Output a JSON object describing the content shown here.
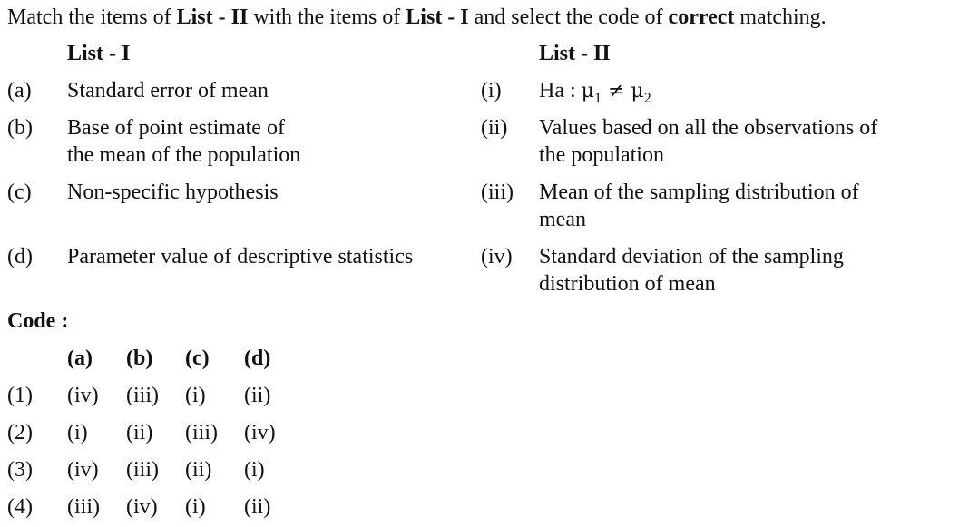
{
  "question": {
    "prefix_1": "Match the items of ",
    "list2_bold": "List - II",
    "prefix_2": " with the items of ",
    "list1_bold": "List - I",
    "prefix_3": " and select the code of ",
    "correct_bold": "correct",
    "suffix": " matching."
  },
  "list1": {
    "heading": "List - I",
    "items": [
      {
        "label": "(a)",
        "lines": [
          "Standard error of mean"
        ]
      },
      {
        "label": "(b)",
        "lines": [
          "Base of point estimate of",
          "the mean of the population"
        ]
      },
      {
        "label": "(c)",
        "lines": [
          "Non-specific hypothesis"
        ]
      },
      {
        "label": "(d)",
        "lines": [
          "Parameter value of descriptive statistics"
        ]
      }
    ]
  },
  "list2": {
    "heading": "List - II",
    "items": [
      {
        "label": "(i)",
        "ha": "Ha : ",
        "mu": "μ",
        "sub1": "1",
        "neq": " ≠ ",
        "sub2": "2"
      },
      {
        "label": "(ii)",
        "lines": [
          "Values based on all the observations of",
          "the population"
        ]
      },
      {
        "label": "(iii)",
        "lines": [
          "Mean of the sampling distribution of",
          "mean"
        ]
      },
      {
        "label": "(iv)",
        "lines": [
          "Standard deviation of the sampling",
          "distribution of mean"
        ]
      }
    ]
  },
  "code": {
    "heading": "Code :",
    "columns": [
      "(a)",
      "(b)",
      "(c)",
      "(d)"
    ],
    "rows": [
      {
        "option": "(1)",
        "values": [
          "(iv)",
          "(iii)",
          "(i)",
          "(ii)"
        ]
      },
      {
        "option": "(2)",
        "values": [
          "(i)",
          "(ii)",
          "(iii)",
          "(iv)"
        ]
      },
      {
        "option": "(3)",
        "values": [
          "(iv)",
          "(iii)",
          "(ii)",
          "(i)"
        ]
      },
      {
        "option": "(4)",
        "values": [
          "(iii)",
          "(iv)",
          "(i)",
          "(ii)"
        ]
      }
    ]
  }
}
